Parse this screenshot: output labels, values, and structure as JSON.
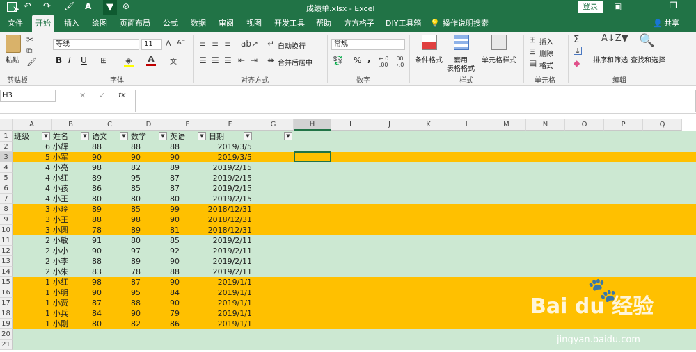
{
  "window": {
    "title": "成绩单.xlsx  -  Excel",
    "login_label": "登录"
  },
  "menu": {
    "items": [
      "文件",
      "开始",
      "插入",
      "绘图",
      "页面布局",
      "公式",
      "数据",
      "审阅",
      "视图",
      "开发工具",
      "帮助",
      "方方格子",
      "DIY工具箱",
      "操作说明搜索"
    ],
    "share": "共享",
    "active_index": 1
  },
  "ribbon": {
    "clipboard": {
      "paste": "粘贴",
      "label": "剪贴板"
    },
    "font": {
      "name": "等线",
      "size": "11",
      "bold": "B",
      "italic": "I",
      "underline": "U",
      "label": "字体"
    },
    "align": {
      "wrap": "自动换行",
      "merge": "合并后居中",
      "label": "对齐方式"
    },
    "number": {
      "format": "常规",
      "label": "数字",
      "percent": "%",
      "comma": ","
    },
    "styles": {
      "cond": "条件格式",
      "table_l1": "套用",
      "table_l2": "表格格式",
      "cell": "单元格样式",
      "label": "样式"
    },
    "cells": {
      "insert": "插入",
      "delete": "删除",
      "format": "格式",
      "label": "单元格"
    },
    "edit": {
      "sort": "排序和筛选",
      "find": "查找和选择",
      "label": "编辑"
    }
  },
  "formula": {
    "name_box": "H3",
    "fx": "fx",
    "value": ""
  },
  "columns": [
    "A",
    "B",
    "C",
    "D",
    "E",
    "F",
    "G",
    "H",
    "I",
    "J",
    "K",
    "L",
    "M",
    "N",
    "O",
    "P",
    "Q"
  ],
  "selected_cell": "H3",
  "headers": [
    "班级",
    "姓名",
    "语文",
    "数学",
    "英语",
    "日期"
  ],
  "rows": [
    {
      "n": "2",
      "c": "6",
      "name": "小辉",
      "yw": "88",
      "sx": "88",
      "yy": "88",
      "date": "2019/3/5",
      "hl": false
    },
    {
      "n": "3",
      "c": "5",
      "name": "小军",
      "yw": "90",
      "sx": "90",
      "yy": "90",
      "date": "2019/3/5",
      "hl": true
    },
    {
      "n": "4",
      "c": "4",
      "name": "小亮",
      "yw": "98",
      "sx": "82",
      "yy": "89",
      "date": "2019/2/15",
      "hl": false
    },
    {
      "n": "5",
      "c": "4",
      "name": "小红",
      "yw": "89",
      "sx": "95",
      "yy": "87",
      "date": "2019/2/15",
      "hl": false
    },
    {
      "n": "6",
      "c": "4",
      "name": "小孩",
      "yw": "86",
      "sx": "85",
      "yy": "87",
      "date": "2019/2/15",
      "hl": false
    },
    {
      "n": "7",
      "c": "4",
      "name": "小王",
      "yw": "80",
      "sx": "80",
      "yy": "80",
      "date": "2019/2/15",
      "hl": false
    },
    {
      "n": "8",
      "c": "3",
      "name": "小玲",
      "yw": "89",
      "sx": "85",
      "yy": "99",
      "date": "2018/12/31",
      "hl": true
    },
    {
      "n": "9",
      "c": "3",
      "name": "小王",
      "yw": "88",
      "sx": "98",
      "yy": "90",
      "date": "2018/12/31",
      "hl": true
    },
    {
      "n": "10",
      "c": "3",
      "name": "小圆",
      "yw": "78",
      "sx": "89",
      "yy": "81",
      "date": "2018/12/31",
      "hl": true
    },
    {
      "n": "11",
      "c": "2",
      "name": "小敏",
      "yw": "91",
      "sx": "80",
      "yy": "85",
      "date": "2019/2/11",
      "hl": false
    },
    {
      "n": "12",
      "c": "2",
      "name": "小小",
      "yw": "90",
      "sx": "97",
      "yy": "92",
      "date": "2019/2/11",
      "hl": false
    },
    {
      "n": "13",
      "c": "2",
      "name": "小李",
      "yw": "88",
      "sx": "89",
      "yy": "90",
      "date": "2019/2/11",
      "hl": false
    },
    {
      "n": "14",
      "c": "2",
      "name": "小朱",
      "yw": "83",
      "sx": "78",
      "yy": "88",
      "date": "2019/2/11",
      "hl": false
    },
    {
      "n": "15",
      "c": "1",
      "name": "小红",
      "yw": "98",
      "sx": "87",
      "yy": "90",
      "date": "2019/1/1",
      "hl": true
    },
    {
      "n": "16",
      "c": "1",
      "name": "小明",
      "yw": "90",
      "sx": "95",
      "yy": "84",
      "date": "2019/1/1",
      "hl": true
    },
    {
      "n": "17",
      "c": "1",
      "name": "小贾",
      "yw": "87",
      "sx": "88",
      "yy": "90",
      "date": "2019/1/1",
      "hl": true
    },
    {
      "n": "18",
      "c": "1",
      "name": "小兵",
      "yw": "84",
      "sx": "90",
      "yy": "79",
      "date": "2019/1/1",
      "hl": true
    },
    {
      "n": "19",
      "c": "1",
      "name": "小刚",
      "yw": "80",
      "sx": "82",
      "yy": "86",
      "date": "2019/1/1",
      "hl": true
    }
  ],
  "empty_rows": [
    "20",
    "21"
  ],
  "colors": {
    "excel_green": "#217346",
    "row_green": "#cce8d2",
    "row_orange": "#ffc000"
  },
  "watermark": {
    "brand": "Bai du 经验",
    "url": "jingyan.baidu.com"
  }
}
